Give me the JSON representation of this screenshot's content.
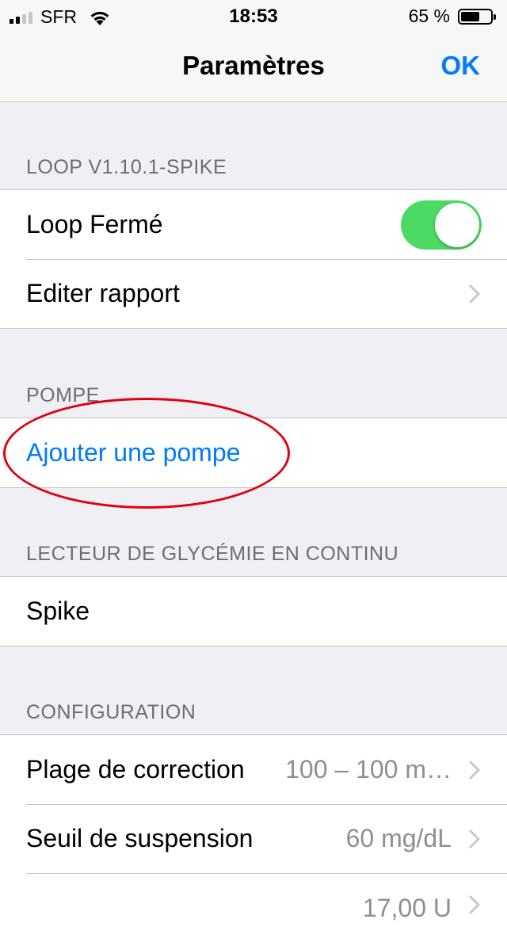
{
  "status_bar": {
    "carrier": "SFR",
    "time": "18:53",
    "battery": "65 %",
    "battery_level": 0.65
  },
  "nav": {
    "title": "Paramètres",
    "done_label": "OK"
  },
  "sections": {
    "loop": {
      "header": "LOOP V1.10.1-SPIKE",
      "closed_loop_label": "Loop Fermé",
      "closed_loop_enabled": true,
      "edit_report_label": "Editer rapport"
    },
    "pump": {
      "header": "POMPE",
      "add_pump_label": "Ajouter une pompe"
    },
    "cgm": {
      "header": "LECTEUR DE GLYCÉMIE EN CONTINU",
      "device_label": "Spike"
    },
    "configuration": {
      "header": "CONFIGURATION",
      "correction_range_label": "Plage de correction",
      "correction_range_value": "100 – 100 m…",
      "suspend_threshold_label": "Seuil de suspension",
      "suspend_threshold_value": "60 mg/dL",
      "next_row_value": "17,00 U"
    }
  },
  "colors": {
    "accent": "#007aff",
    "toggle_on": "#4cd964",
    "annotation": "#e0000f",
    "background": "#efeff4"
  }
}
